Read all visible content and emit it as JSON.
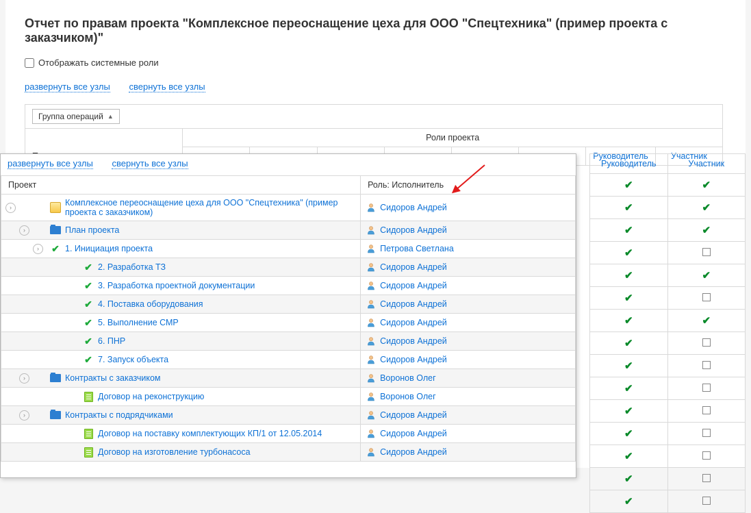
{
  "title": "Отчет по правам проекта \"Комплексное переоснащение цеха для ООО \"Спецтехника\" (пример проекта с заказчиком)\"",
  "checkbox": {
    "label": "Отображать системные роли"
  },
  "links": {
    "expand": "развернуть все узлы",
    "collapse": "свернуть все узлы"
  },
  "group_dd": "Группа операций",
  "bg_headers": {
    "rights": "Права",
    "roles": "Роли проекта"
  },
  "bg_roles": [
    "Руководитель",
    "Участник"
  ],
  "popup": {
    "links": {
      "expand": "развернуть все узлы",
      "collapse": "свернуть все узлы"
    },
    "headers": {
      "project": "Проект",
      "role": "Роль: Исполнитель"
    },
    "rows": [
      {
        "lvl": 0,
        "icon": "proj",
        "toggle": true,
        "label": "Комплексное переоснащение цеха для ООО \"Спецтехника\" (пример проекта с заказчиком)",
        "exec": "Сидоров Андрей",
        "alt": false
      },
      {
        "lvl": 1,
        "icon": "folder",
        "toggle": true,
        "label": "План проекта",
        "exec": "Сидоров Андрей",
        "alt": true
      },
      {
        "lvl": 2,
        "icon": "tick",
        "toggle": true,
        "label": "1. Инициация проекта",
        "exec": "Петрова Светлана",
        "alt": false
      },
      {
        "lvl": 2,
        "icon": "tick",
        "toggle": false,
        "label": "2. Разработка ТЗ",
        "exec": "Сидоров Андрей",
        "alt": true
      },
      {
        "lvl": 2,
        "icon": "tick",
        "toggle": false,
        "label": "3. Разработка проектной документации",
        "exec": "Сидоров Андрей",
        "alt": false
      },
      {
        "lvl": 2,
        "icon": "tick",
        "toggle": false,
        "label": "4. Поставка оборудования",
        "exec": "Сидоров Андрей",
        "alt": true
      },
      {
        "lvl": 2,
        "icon": "tick",
        "toggle": false,
        "label": "5. Выполнение СМР",
        "exec": "Сидоров Андрей",
        "alt": false
      },
      {
        "lvl": 2,
        "icon": "tick",
        "toggle": false,
        "label": "6. ПНР",
        "exec": "Сидоров Андрей",
        "alt": true
      },
      {
        "lvl": 2,
        "icon": "tick",
        "toggle": false,
        "label": "7. Запуск объекта",
        "exec": "Сидоров Андрей",
        "alt": false
      },
      {
        "lvl": 1,
        "icon": "folder",
        "toggle": true,
        "label": "Контракты с заказчиком",
        "exec": "Воронов Олег",
        "alt": true
      },
      {
        "lvl": 2,
        "icon": "doc",
        "toggle": false,
        "label": "Договор на реконструкцию",
        "exec": "Воронов Олег",
        "alt": false
      },
      {
        "lvl": 1,
        "icon": "folder",
        "toggle": true,
        "label": "Контракты с подрядчиками",
        "exec": "Сидоров Андрей",
        "alt": true
      },
      {
        "lvl": 2,
        "icon": "doc",
        "toggle": false,
        "label": "Договор на поставку комплектующих КП/1 от 12.05.2014",
        "exec": "Сидоров Андрей",
        "alt": false
      },
      {
        "lvl": 2,
        "icon": "doc",
        "toggle": false,
        "label": "Договор на изготовление турбонасоса",
        "exec": "Сидоров Андрей",
        "alt": true
      }
    ]
  },
  "right_matrix": [
    [
      "check",
      "check"
    ],
    [
      "check",
      "check"
    ],
    [
      "check",
      "check"
    ],
    [
      "check",
      "box"
    ],
    [
      "check",
      "check"
    ],
    [
      "check",
      "box"
    ],
    [
      "check",
      "check"
    ],
    [
      "check",
      "box"
    ],
    [
      "check",
      "box"
    ],
    [
      "check",
      "box"
    ],
    [
      "check",
      "box"
    ],
    [
      "check",
      "box"
    ],
    [
      "check",
      "box"
    ],
    [
      "check",
      "box"
    ],
    [
      "check",
      "box"
    ]
  ]
}
